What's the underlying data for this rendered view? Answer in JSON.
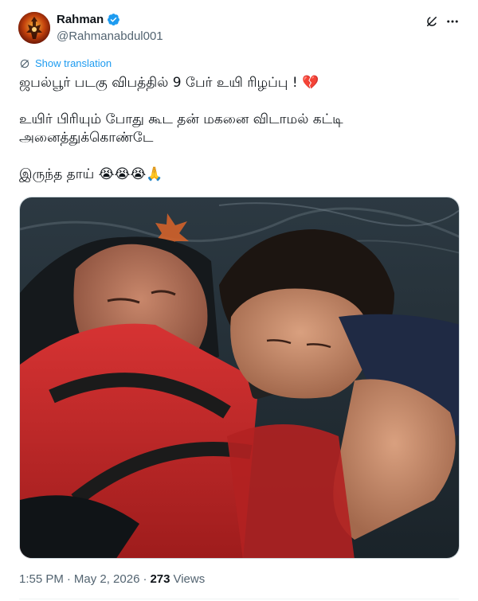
{
  "author": {
    "display_name": "Rahman",
    "handle": "@Rahmanabdul001",
    "verified": true
  },
  "icons": {
    "grok": "grok-icon",
    "more": "more-icon",
    "translate": "translate-icon",
    "verified": "verified-badge-icon"
  },
  "translate_label": "Show translation",
  "text": {
    "line1": "ஜபல்பூர் படகு விபத்தில் 9 பேர் உயி ரிழப்பு ! 💔",
    "line2": "உயிர் பிரியும் போது கூட தன் மகனை விடாமல் கட்டி",
    "line3": "அனைத்துக்கொண்டே",
    "line4": "இருந்த தாய் 😭😭😭🙏"
  },
  "meta": {
    "time": "1:55 PM",
    "dot1": "·",
    "date": "May 2, 2026",
    "dot2": "·",
    "views_count": "273",
    "views_label": "Views"
  },
  "colors": {
    "accent": "#1d9bf0",
    "secondary_text": "#536471",
    "primary_text": "#0f1419"
  }
}
